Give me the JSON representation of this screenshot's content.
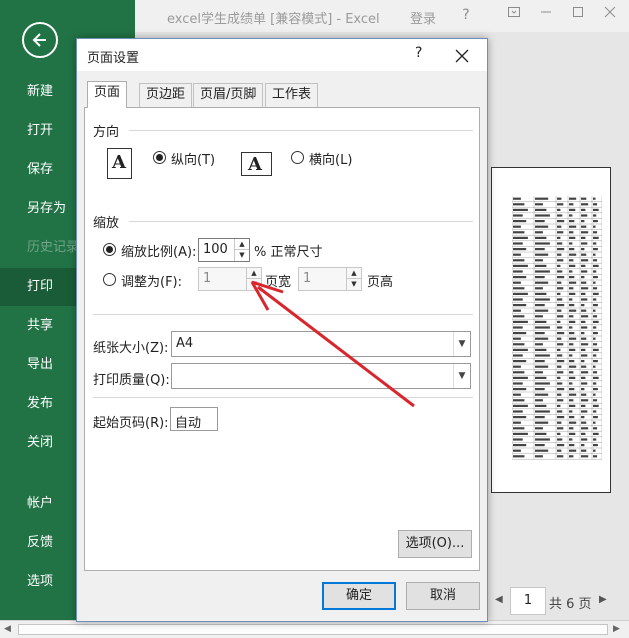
{
  "window": {
    "title": "excel学生成绩单 [兼容模式] - Excel",
    "login": "登录",
    "help": "?"
  },
  "sidebar": {
    "items": [
      {
        "label": "新建",
        "state": "normal"
      },
      {
        "label": "打开",
        "state": "normal"
      },
      {
        "label": "保存",
        "state": "normal"
      },
      {
        "label": "另存为",
        "state": "normal"
      },
      {
        "label": "历史记录",
        "state": "disabled"
      },
      {
        "label": "打印",
        "state": "active"
      },
      {
        "label": "共享",
        "state": "normal"
      },
      {
        "label": "导出",
        "state": "normal"
      },
      {
        "label": "发布",
        "state": "normal"
      },
      {
        "label": "关闭",
        "state": "normal"
      },
      {
        "label": "帐户",
        "state": "normal"
      },
      {
        "label": "反馈",
        "state": "normal"
      },
      {
        "label": "选项",
        "state": "normal"
      }
    ]
  },
  "dialog": {
    "title": "页面设置",
    "help": "?",
    "tabs": [
      {
        "label": "页面",
        "active": true
      },
      {
        "label": "页边距",
        "active": false
      },
      {
        "label": "页眉/页脚",
        "active": false
      },
      {
        "label": "工作表",
        "active": false
      }
    ],
    "orientation": {
      "section": "方向",
      "portrait_label": "纵向(T)",
      "landscape_label": "横向(L)",
      "icon_letter": "A",
      "selected": "portrait"
    },
    "scaling": {
      "section": "缩放",
      "adjust_label": "缩放比例(A):",
      "adjust_value": "100",
      "adjust_suffix": "% 正常尺寸",
      "fit_label": "调整为(F):",
      "fit_wide_value": "1",
      "fit_wide_suffix": "页宽",
      "fit_tall_value": "1",
      "fit_tall_suffix": "页高",
      "selected": "adjust"
    },
    "paper_size_label": "纸张大小(Z):",
    "paper_size_value": "A4",
    "print_quality_label": "打印质量(Q):",
    "print_quality_value": "",
    "first_page_label": "起始页码(R):",
    "first_page_value": "自动",
    "options_button": "选项(O)...",
    "ok_button": "确定",
    "cancel_button": "取消"
  },
  "preview": {
    "page_number": "1",
    "page_total": "共 6 页"
  },
  "colors": {
    "sidebar": "#217346",
    "annotation_arrow": "#d9262c",
    "dialog_default_border": "#0078d7"
  },
  "annotation": {
    "type": "arrow",
    "points_to": "fit-wide-spin-up"
  }
}
